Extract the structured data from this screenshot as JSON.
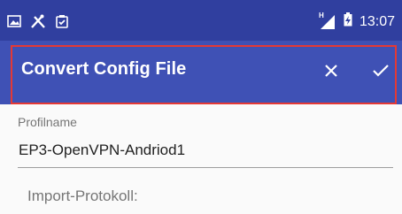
{
  "status_bar": {
    "icons_left": [
      "image-icon",
      "tools-icon",
      "clipboard-check-icon"
    ],
    "network_type": "H",
    "time": "13:07"
  },
  "toolbar": {
    "title": "Convert Config File",
    "close_icon": "close-icon",
    "confirm_icon": "check-icon",
    "background": "#3f51b5",
    "status_bar_color": "#303f9f",
    "highlight_color": "#e53935"
  },
  "form": {
    "profile_label": "Profilname",
    "profile_value": "EP3-OpenVPN-Andriod1",
    "import_label": "Import-Protokoll:"
  }
}
